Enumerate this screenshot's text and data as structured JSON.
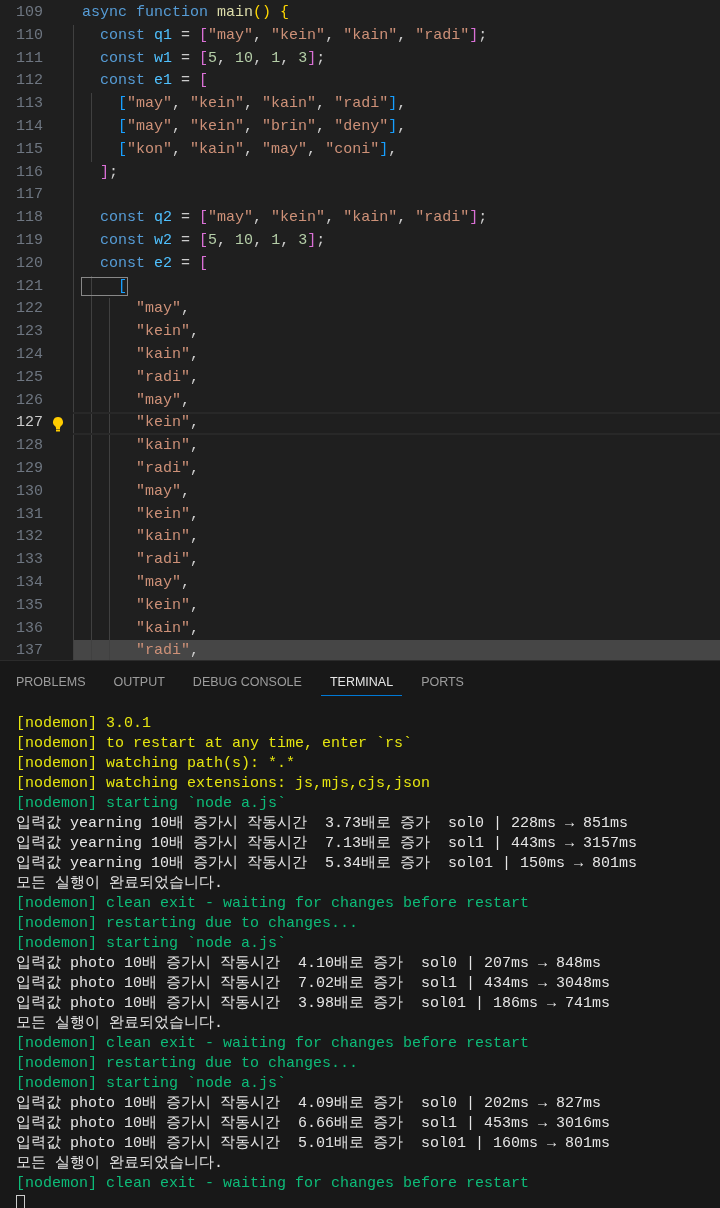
{
  "editor": {
    "lines": [
      {
        "number": "109",
        "current": false,
        "highlighted": false,
        "lightbulb": false,
        "tokens": [
          {
            "kind": "kw",
            "text": "async "
          },
          {
            "kind": "kw",
            "text": "function "
          },
          {
            "kind": "fn",
            "text": "main"
          },
          {
            "kind": "b0",
            "text": "() "
          },
          {
            "kind": "b0",
            "text": "{"
          }
        ]
      },
      {
        "number": "110",
        "current": false,
        "highlighted": false,
        "lightbulb": false,
        "tokens": [
          {
            "kind": "kw",
            "text": "  const "
          },
          {
            "kind": "var",
            "text": "q1"
          },
          {
            "kind": "p",
            "text": " = "
          },
          {
            "kind": "b1",
            "text": "["
          },
          {
            "kind": "str",
            "text": "\"may\""
          },
          {
            "kind": "p",
            "text": ", "
          },
          {
            "kind": "str",
            "text": "\"kein\""
          },
          {
            "kind": "p",
            "text": ", "
          },
          {
            "kind": "str",
            "text": "\"kain\""
          },
          {
            "kind": "p",
            "text": ", "
          },
          {
            "kind": "str",
            "text": "\"radi\""
          },
          {
            "kind": "b1",
            "text": "]"
          },
          {
            "kind": "p",
            "text": ";"
          }
        ]
      },
      {
        "number": "111",
        "current": false,
        "highlighted": false,
        "lightbulb": false,
        "tokens": [
          {
            "kind": "kw",
            "text": "  const "
          },
          {
            "kind": "var",
            "text": "w1"
          },
          {
            "kind": "p",
            "text": " = "
          },
          {
            "kind": "b1",
            "text": "["
          },
          {
            "kind": "num",
            "text": "5"
          },
          {
            "kind": "p",
            "text": ", "
          },
          {
            "kind": "num",
            "text": "10"
          },
          {
            "kind": "p",
            "text": ", "
          },
          {
            "kind": "num",
            "text": "1"
          },
          {
            "kind": "p",
            "text": ", "
          },
          {
            "kind": "num",
            "text": "3"
          },
          {
            "kind": "b1",
            "text": "]"
          },
          {
            "kind": "p",
            "text": ";"
          }
        ]
      },
      {
        "number": "112",
        "current": false,
        "highlighted": false,
        "lightbulb": false,
        "tokens": [
          {
            "kind": "kw",
            "text": "  const "
          },
          {
            "kind": "var",
            "text": "e1"
          },
          {
            "kind": "p",
            "text": " = "
          },
          {
            "kind": "b1",
            "text": "["
          }
        ]
      },
      {
        "number": "113",
        "current": false,
        "highlighted": false,
        "lightbulb": false,
        "tokens": [
          {
            "kind": "b2",
            "text": "    ["
          },
          {
            "kind": "str",
            "text": "\"may\""
          },
          {
            "kind": "p",
            "text": ", "
          },
          {
            "kind": "str",
            "text": "\"kein\""
          },
          {
            "kind": "p",
            "text": ", "
          },
          {
            "kind": "str",
            "text": "\"kain\""
          },
          {
            "kind": "p",
            "text": ", "
          },
          {
            "kind": "str",
            "text": "\"radi\""
          },
          {
            "kind": "b2",
            "text": "]"
          },
          {
            "kind": "p",
            "text": ","
          }
        ]
      },
      {
        "number": "114",
        "current": false,
        "highlighted": false,
        "lightbulb": false,
        "tokens": [
          {
            "kind": "b2",
            "text": "    ["
          },
          {
            "kind": "str",
            "text": "\"may\""
          },
          {
            "kind": "p",
            "text": ", "
          },
          {
            "kind": "str",
            "text": "\"kein\""
          },
          {
            "kind": "p",
            "text": ", "
          },
          {
            "kind": "str",
            "text": "\"brin\""
          },
          {
            "kind": "p",
            "text": ", "
          },
          {
            "kind": "str",
            "text": "\"deny\""
          },
          {
            "kind": "b2",
            "text": "]"
          },
          {
            "kind": "p",
            "text": ","
          }
        ]
      },
      {
        "number": "115",
        "current": false,
        "highlighted": false,
        "lightbulb": false,
        "tokens": [
          {
            "kind": "b2",
            "text": "    ["
          },
          {
            "kind": "str",
            "text": "\"kon\""
          },
          {
            "kind": "p",
            "text": ", "
          },
          {
            "kind": "str",
            "text": "\"kain\""
          },
          {
            "kind": "p",
            "text": ", "
          },
          {
            "kind": "str",
            "text": "\"may\""
          },
          {
            "kind": "p",
            "text": ", "
          },
          {
            "kind": "str",
            "text": "\"coni\""
          },
          {
            "kind": "b2",
            "text": "]"
          },
          {
            "kind": "p",
            "text": ","
          }
        ]
      },
      {
        "number": "116",
        "current": false,
        "highlighted": false,
        "lightbulb": false,
        "tokens": [
          {
            "kind": "b1",
            "text": "  ]"
          },
          {
            "kind": "p",
            "text": ";"
          }
        ]
      },
      {
        "number": "117",
        "current": false,
        "highlighted": false,
        "lightbulb": false
      },
      {
        "number": "118",
        "current": false,
        "highlighted": false,
        "lightbulb": false,
        "tokens": [
          {
            "kind": "kw",
            "text": "  const "
          },
          {
            "kind": "var",
            "text": "q2"
          },
          {
            "kind": "p",
            "text": " = "
          },
          {
            "kind": "b1",
            "text": "["
          },
          {
            "kind": "str",
            "text": "\"may\""
          },
          {
            "kind": "p",
            "text": ", "
          },
          {
            "kind": "str",
            "text": "\"kein\""
          },
          {
            "kind": "p",
            "text": ", "
          },
          {
            "kind": "str",
            "text": "\"kain\""
          },
          {
            "kind": "p",
            "text": ", "
          },
          {
            "kind": "str",
            "text": "\"radi\""
          },
          {
            "kind": "b1",
            "text": "]"
          },
          {
            "kind": "p",
            "text": ";"
          }
        ]
      },
      {
        "number": "119",
        "current": false,
        "highlighted": false,
        "lightbulb": false,
        "tokens": [
          {
            "kind": "kw",
            "text": "  const "
          },
          {
            "kind": "var",
            "text": "w2"
          },
          {
            "kind": "p",
            "text": " = "
          },
          {
            "kind": "b1",
            "text": "["
          },
          {
            "kind": "num",
            "text": "5"
          },
          {
            "kind": "p",
            "text": ", "
          },
          {
            "kind": "num",
            "text": "10"
          },
          {
            "kind": "p",
            "text": ", "
          },
          {
            "kind": "num",
            "text": "1"
          },
          {
            "kind": "p",
            "text": ", "
          },
          {
            "kind": "num",
            "text": "3"
          },
          {
            "kind": "b1",
            "text": "]"
          },
          {
            "kind": "p",
            "text": ";"
          }
        ]
      },
      {
        "number": "120",
        "current": false,
        "highlighted": false,
        "lightbulb": false,
        "tokens": [
          {
            "kind": "kw",
            "text": "  const "
          },
          {
            "kind": "var",
            "text": "e2"
          },
          {
            "kind": "p",
            "text": " = "
          },
          {
            "kind": "b1",
            "text": "["
          }
        ]
      },
      {
        "number": "121",
        "current": false,
        "highlighted": false,
        "lightbulb": false,
        "tokens": [
          {
            "kind": "bm",
            "text": "    ["
          }
        ]
      },
      {
        "number": "122",
        "current": false,
        "highlighted": false,
        "lightbulb": false,
        "tokens": [
          {
            "kind": "str",
            "text": "      \"may\""
          },
          {
            "kind": "p",
            "text": ","
          }
        ]
      },
      {
        "number": "123",
        "current": false,
        "highlighted": false,
        "lightbulb": false,
        "tokens": [
          {
            "kind": "str",
            "text": "      \"kein\""
          },
          {
            "kind": "p",
            "text": ","
          }
        ]
      },
      {
        "number": "124",
        "current": false,
        "highlighted": false,
        "lightbulb": false,
        "tokens": [
          {
            "kind": "str",
            "text": "      \"kain\""
          },
          {
            "kind": "p",
            "text": ","
          }
        ]
      },
      {
        "number": "125",
        "current": false,
        "highlighted": false,
        "lightbulb": false,
        "tokens": [
          {
            "kind": "str",
            "text": "      \"radi\""
          },
          {
            "kind": "p",
            "text": ","
          }
        ]
      },
      {
        "number": "126",
        "current": false,
        "highlighted": false,
        "lightbulb": false,
        "tokens": [
          {
            "kind": "str",
            "text": "      \"may\""
          },
          {
            "kind": "p",
            "text": ","
          }
        ]
      },
      {
        "number": "127",
        "current": true,
        "highlighted": false,
        "lightbulb": true,
        "tokens": [
          {
            "kind": "str",
            "text": "      \"kein\""
          },
          {
            "kind": "p",
            "text": ","
          }
        ]
      },
      {
        "number": "128",
        "current": false,
        "highlighted": false,
        "lightbulb": false,
        "tokens": [
          {
            "kind": "str",
            "text": "      \"kain\""
          },
          {
            "kind": "p",
            "text": ","
          }
        ]
      },
      {
        "number": "129",
        "current": false,
        "highlighted": false,
        "lightbulb": false,
        "tokens": [
          {
            "kind": "str",
            "text": "      \"radi\""
          },
          {
            "kind": "p",
            "text": ","
          }
        ]
      },
      {
        "number": "130",
        "current": false,
        "highlighted": false,
        "lightbulb": false,
        "tokens": [
          {
            "kind": "str",
            "text": "      \"may\""
          },
          {
            "kind": "p",
            "text": ","
          }
        ]
      },
      {
        "number": "131",
        "current": false,
        "highlighted": false,
        "lightbulb": false,
        "tokens": [
          {
            "kind": "str",
            "text": "      \"kein\""
          },
          {
            "kind": "p",
            "text": ","
          }
        ]
      },
      {
        "number": "132",
        "current": false,
        "highlighted": false,
        "lightbulb": false,
        "tokens": [
          {
            "kind": "str",
            "text": "      \"kain\""
          },
          {
            "kind": "p",
            "text": ","
          }
        ]
      },
      {
        "number": "133",
        "current": false,
        "highlighted": false,
        "lightbulb": false,
        "tokens": [
          {
            "kind": "str",
            "text": "      \"radi\""
          },
          {
            "kind": "p",
            "text": ","
          }
        ]
      },
      {
        "number": "134",
        "current": false,
        "highlighted": false,
        "lightbulb": false,
        "tokens": [
          {
            "kind": "str",
            "text": "      \"may\""
          },
          {
            "kind": "p",
            "text": ","
          }
        ]
      },
      {
        "number": "135",
        "current": false,
        "highlighted": false,
        "lightbulb": false,
        "tokens": [
          {
            "kind": "str",
            "text": "      \"kein\""
          },
          {
            "kind": "p",
            "text": ","
          }
        ]
      },
      {
        "number": "136",
        "current": false,
        "highlighted": false,
        "lightbulb": false,
        "tokens": [
          {
            "kind": "str",
            "text": "      \"kain\""
          },
          {
            "kind": "p",
            "text": ","
          }
        ]
      },
      {
        "number": "137",
        "current": false,
        "highlighted": true,
        "lightbulb": false,
        "tokens": [
          {
            "kind": "str",
            "text": "      \"radi\""
          },
          {
            "kind": "p",
            "text": ","
          }
        ]
      }
    ]
  },
  "panel": {
    "tabs": [
      {
        "label": "PROBLEMS",
        "selected": false
      },
      {
        "label": "OUTPUT",
        "selected": false
      },
      {
        "label": "DEBUG CONSOLE",
        "selected": false
      },
      {
        "label": "TERMINAL",
        "selected": true
      },
      {
        "label": "PORTS",
        "selected": false
      }
    ],
    "terminal": {
      "cursor": true,
      "lines": [
        {
          "kind": "info",
          "text": "[nodemon] 3.0.1"
        },
        {
          "kind": "info",
          "text": "[nodemon] to restart at any time, enter `rs`"
        },
        {
          "kind": "info",
          "text": "[nodemon] watching path(s): *.*"
        },
        {
          "kind": "info",
          "text": "[nodemon] watching extensions: js,mjs,cjs,json"
        },
        {
          "kind": "status",
          "text": "[nodemon] starting `node a.js`"
        },
        {
          "kind": "output",
          "text": "입력값 yearning 10배 증가시 작동시간  3.73배로 증가  sol0 | 228ms → 851ms"
        },
        {
          "kind": "output",
          "text": "입력값 yearning 10배 증가시 작동시간  7.13배로 증가  sol1 | 443ms → 3157ms"
        },
        {
          "kind": "output",
          "text": "입력값 yearning 10배 증가시 작동시간  5.34배로 증가  sol01 | 150ms → 801ms"
        },
        {
          "kind": "output",
          "text": "모든 실행이 완료되었습니다."
        },
        {
          "kind": "status",
          "text": "[nodemon] clean exit - waiting for changes before restart"
        },
        {
          "kind": "status",
          "text": "[nodemon] restarting due to changes..."
        },
        {
          "kind": "status",
          "text": "[nodemon] starting `node a.js`"
        },
        {
          "kind": "output",
          "text": "입력값 photo 10배 증가시 작동시간  4.10배로 증가  sol0 | 207ms → 848ms"
        },
        {
          "kind": "output",
          "text": "입력값 photo 10배 증가시 작동시간  7.02배로 증가  sol1 | 434ms → 3048ms"
        },
        {
          "kind": "output",
          "text": "입력값 photo 10배 증가시 작동시간  3.98배로 증가  sol01 | 186ms → 741ms"
        },
        {
          "kind": "output",
          "text": "모든 실행이 완료되었습니다."
        },
        {
          "kind": "status",
          "text": "[nodemon] clean exit - waiting for changes before restart"
        },
        {
          "kind": "status",
          "text": "[nodemon] restarting due to changes..."
        },
        {
          "kind": "status",
          "text": "[nodemon] starting `node a.js`"
        },
        {
          "kind": "output",
          "text": "입력값 photo 10배 증가시 작동시간  4.09배로 증가  sol0 | 202ms → 827ms"
        },
        {
          "kind": "output",
          "text": "입력값 photo 10배 증가시 작동시간  6.66배로 증가  sol1 | 453ms → 3016ms"
        },
        {
          "kind": "output",
          "text": "입력값 photo 10배 증가시 작동시간  5.01배로 증가  sol01 | 160ms → 801ms"
        },
        {
          "kind": "output",
          "text": "모든 실행이 완료되었습니다."
        },
        {
          "kind": "status",
          "text": "[nodemon] clean exit - waiting for changes before restart"
        }
      ]
    }
  }
}
